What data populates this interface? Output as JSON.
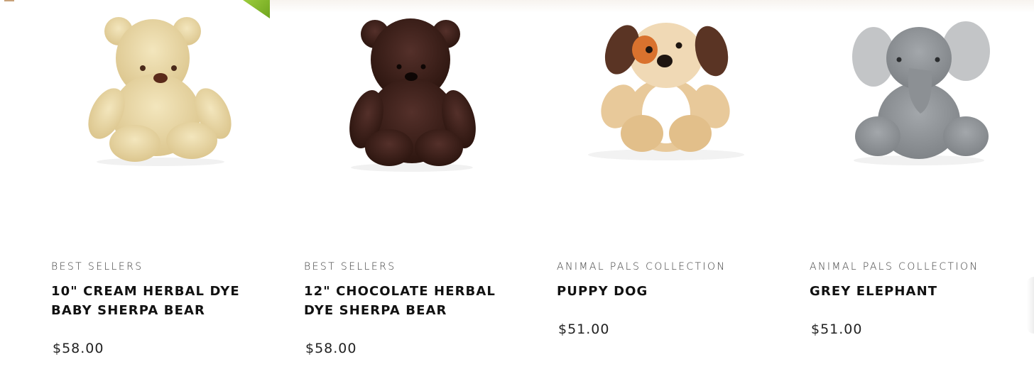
{
  "products": [
    {
      "category": "BEST SELLERS",
      "title": "10\" CREAM HERBAL DYE BABY SHERPA BEAR",
      "price": "$58.00",
      "image_icon": "cream-teddy-bear-icon",
      "color": "#e8d8a8"
    },
    {
      "category": "BEST SELLERS",
      "title": "12\" CHOCOLATE HERBAL DYE SHERPA BEAR",
      "price": "$58.00",
      "image_icon": "chocolate-teddy-bear-icon",
      "color": "#3a2018"
    },
    {
      "category": "ANIMAL PALS COLLECTION",
      "title": "PUPPY DOG",
      "price": "$51.00",
      "image_icon": "puppy-dog-plush-icon",
      "color": "#e8c99a"
    },
    {
      "category": "ANIMAL PALS COLLECTION",
      "title": "GREY ELEPHANT",
      "price": "$51.00",
      "image_icon": "grey-elephant-plush-icon",
      "color": "#8e9296"
    }
  ],
  "colors": {
    "ribbon": "#7fb52a",
    "text": "#111111",
    "category_text": "#3a3a3a"
  }
}
